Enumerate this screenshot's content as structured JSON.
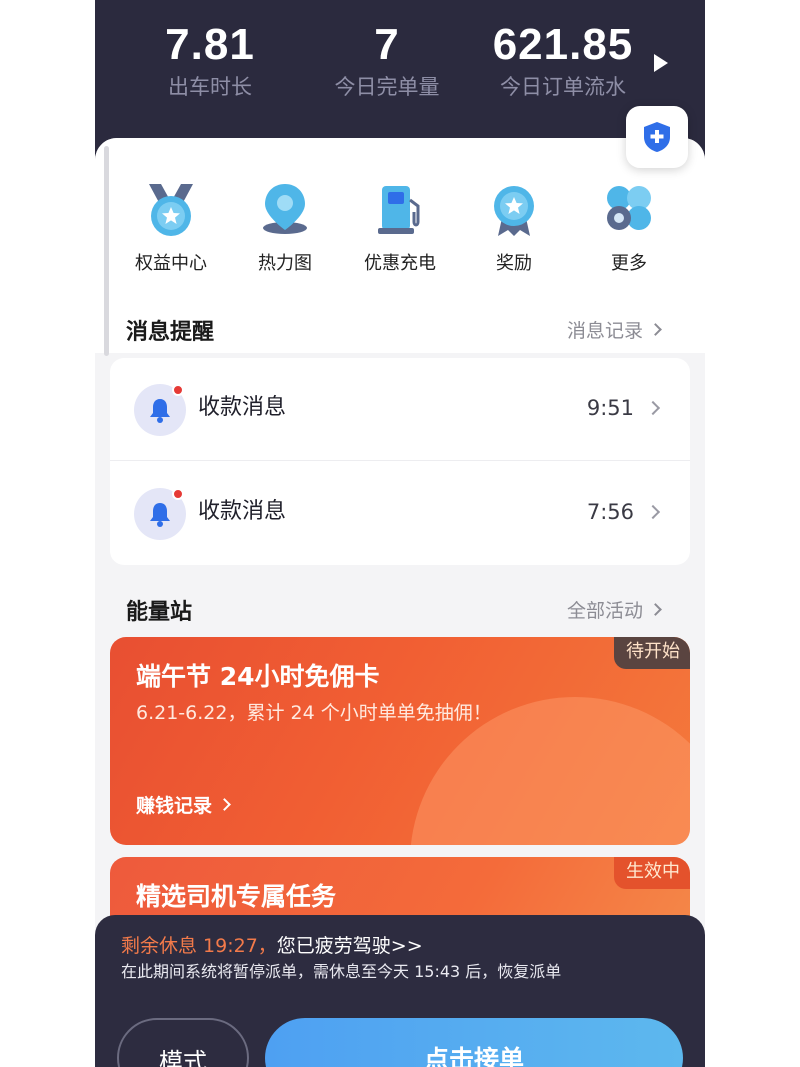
{
  "header": {
    "stats": [
      {
        "value": "7.81",
        "label": "出车时长"
      },
      {
        "value": "7",
        "label": "今日完单量"
      },
      {
        "value": "621.85",
        "label": "今日订单流水"
      }
    ]
  },
  "quick_actions": [
    {
      "label": "权益中心",
      "icon": "medal-icon"
    },
    {
      "label": "热力图",
      "icon": "map-pin-icon"
    },
    {
      "label": "优惠充电",
      "icon": "charging-station-icon"
    },
    {
      "label": "奖励",
      "icon": "award-icon"
    },
    {
      "label": "更多",
      "icon": "more-icon"
    }
  ],
  "messages": {
    "title": "消息提醒",
    "link": "消息记录",
    "items": [
      {
        "title": "收款消息",
        "time": "9:51"
      },
      {
        "title": "收款消息",
        "time": "7:56"
      }
    ]
  },
  "energy": {
    "title": "能量站",
    "link": "全部活动",
    "cards": [
      {
        "badge": "待开始",
        "title": "端午节 24小时免佣卡",
        "subtitle": "6.21-6.22，累计 24 个小时单单免抽佣！",
        "link": "赚钱记录"
      },
      {
        "badge": "生效中",
        "title": "精选司机专属任务"
      }
    ]
  },
  "rest": {
    "remaining": "剩余休息 19:27，",
    "fatigue": "您已疲劳驾驶>>",
    "notice": "在此期间系统将暂停派单，需休息至今天 15:43 后，恢复派单"
  },
  "actions": {
    "mode": "模式",
    "accept": "点击接单"
  },
  "colors": {
    "header_bg": "#2b2a3e",
    "accent_blue": "#2f6ee8",
    "promo_orange": "#f15f33",
    "notification_red": "#e63a36"
  }
}
